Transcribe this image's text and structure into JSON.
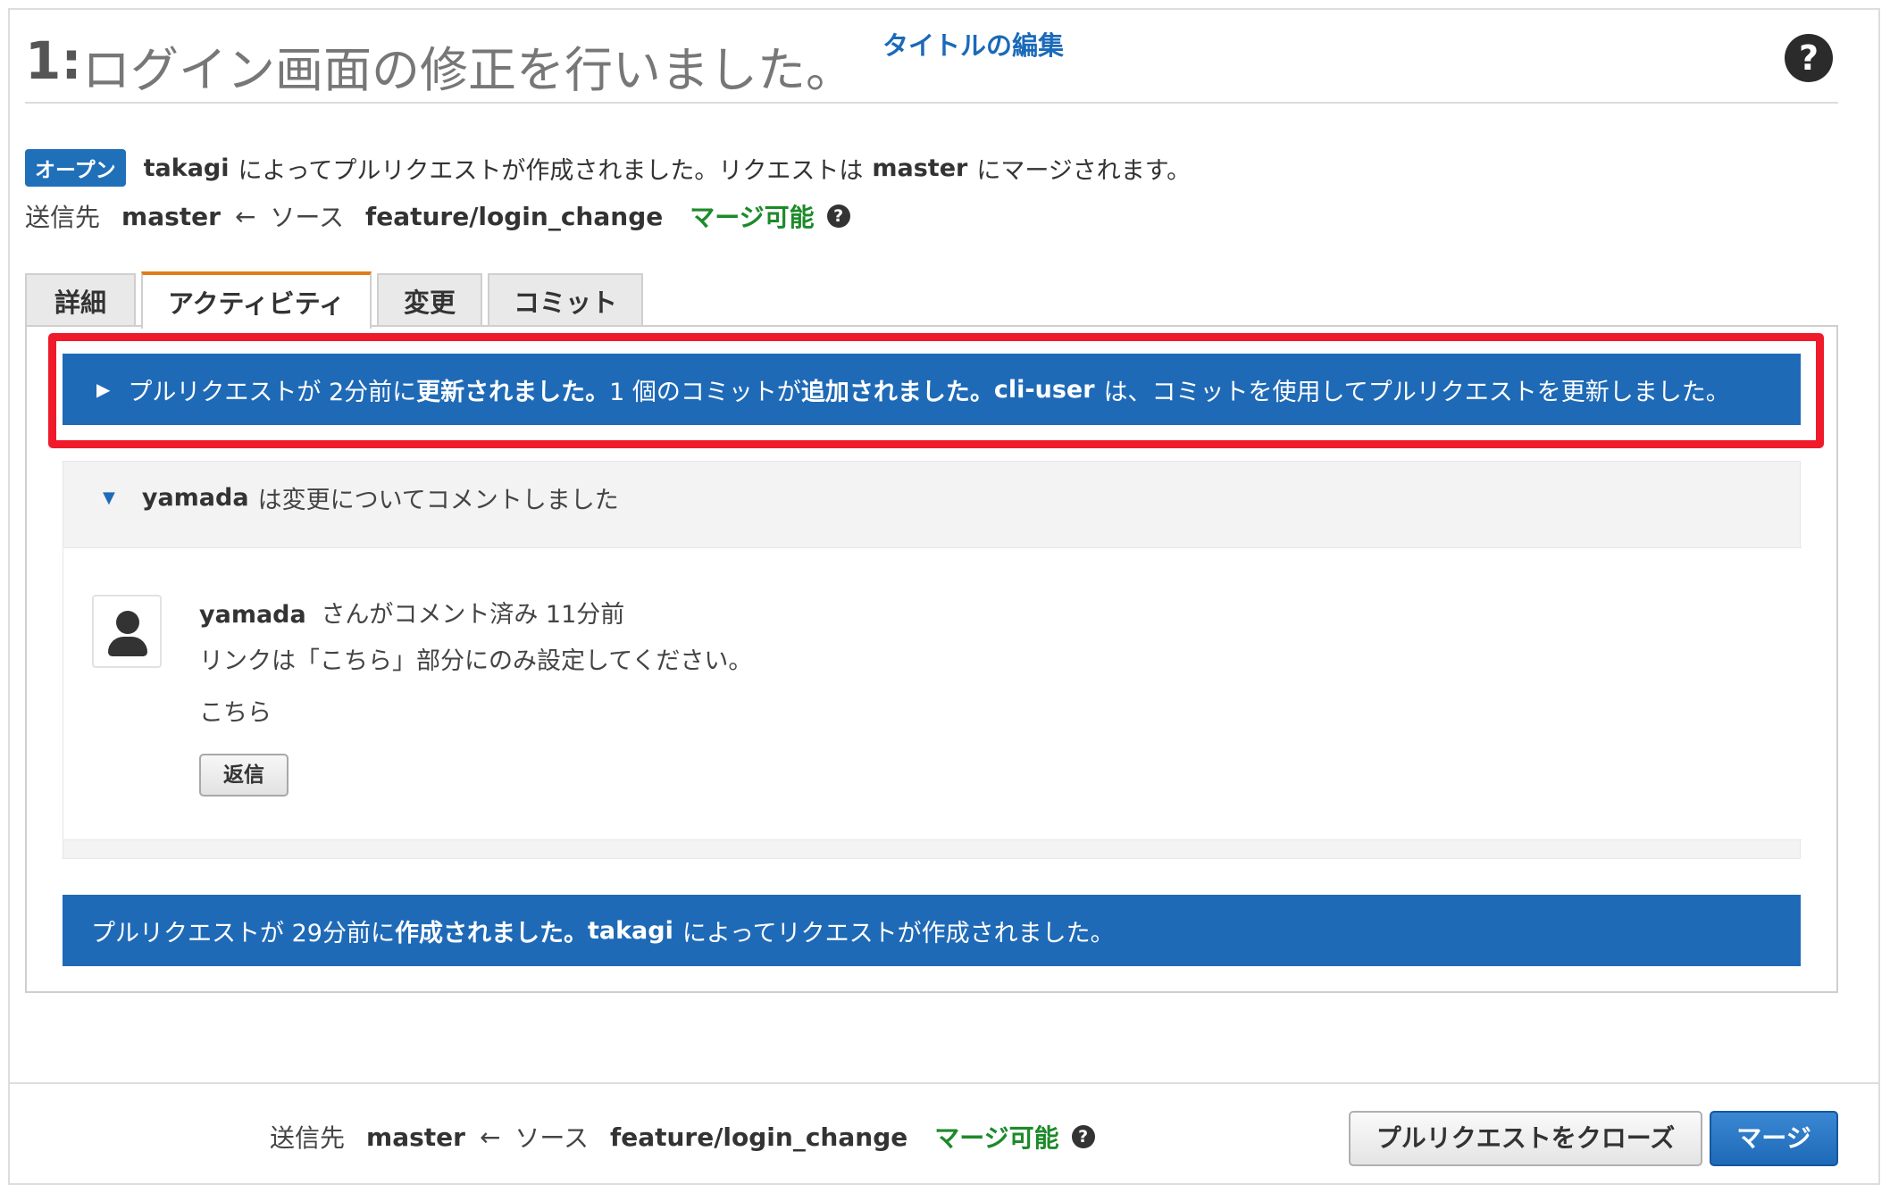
{
  "header": {
    "number": "1:",
    "title": "ログイン画面の修正を行いました。",
    "edit_title_label": "タイトルの編集",
    "help_label": "?"
  },
  "status": {
    "badge": "オープン",
    "author": "takagi",
    "text_mid": "によってプルリクエストが作成されました。リクエストは",
    "target_branch": "master",
    "text_end": "にマージされます。"
  },
  "branches": {
    "destination_label": "送信先",
    "destination": "master",
    "arrow": "←",
    "source_label": "ソース",
    "source": "feature/login_change",
    "mergeable": "マージ可能",
    "help": "?"
  },
  "tabs": [
    {
      "label": "詳細",
      "active": false
    },
    {
      "label": "アクティビティ",
      "active": true
    },
    {
      "label": "変更",
      "active": false
    },
    {
      "label": "コミット",
      "active": false
    }
  ],
  "events": {
    "update": {
      "caret": "▶",
      "p1": "プルリクエストが 2分前に",
      "b1": "更新されました。",
      "p2": "1 個のコミットが",
      "b2": "追加されました。",
      "user": "cli-user",
      "p3": "は、コミットを使用してプルリクエストを更新しました。"
    },
    "created": {
      "p1": "プルリクエストが 29分前に",
      "b1": "作成されました。",
      "user": "takagi",
      "p2": "によってリクエストが作成されました。"
    }
  },
  "thread": {
    "caret": "▼",
    "user": "yamada",
    "head_text": "は変更についてコメントしました",
    "comment": {
      "user": "yamada",
      "meta": "さんがコメント済み 11分前",
      "line1": "リンクは「こちら」部分にのみ設定してください。",
      "line2": "こちら",
      "reply_label": "返信"
    }
  },
  "footer": {
    "destination_label": "送信先",
    "destination": "master",
    "arrow": "←",
    "source_label": "ソース",
    "source": "feature/login_change",
    "mergeable": "マージ可能",
    "help": "?",
    "close_label": "プルリクエストをクローズ",
    "merge_label": "マージ"
  },
  "colors": {
    "accent_blue": "#1f6ab7",
    "merge_green": "#1d8a2a",
    "highlight_red": "#ef1b2a",
    "tab_active_orange": "#e07b18"
  }
}
